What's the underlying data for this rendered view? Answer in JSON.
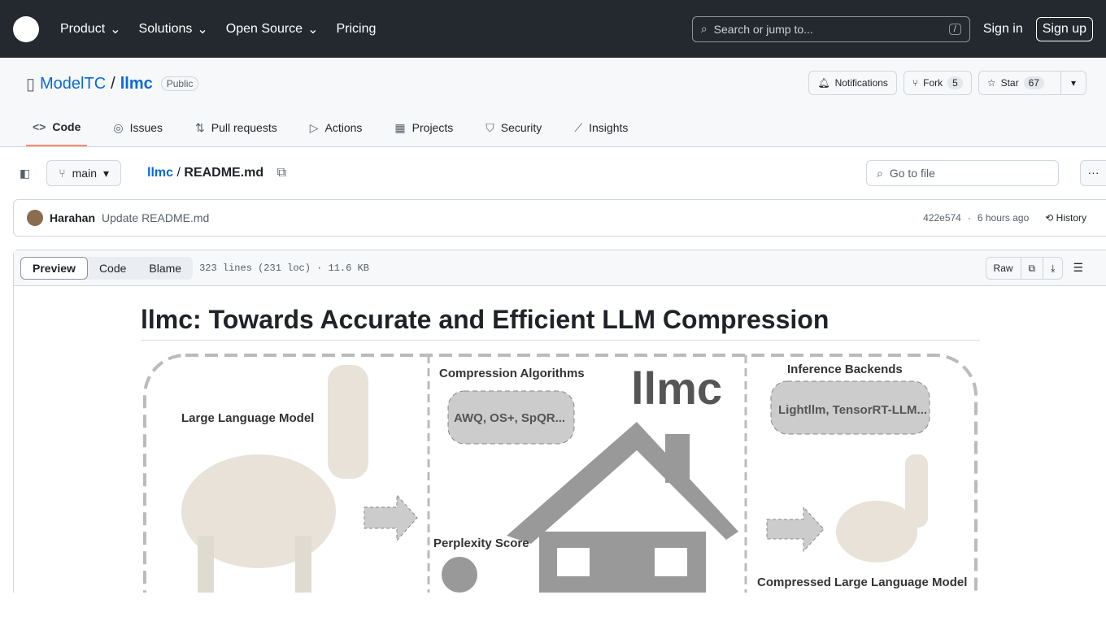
{
  "header": {
    "nav": [
      "Product",
      "Solutions",
      "Open Source",
      "Pricing"
    ],
    "search_placeholder": "Search or jump to...",
    "search_key": "/",
    "sign_in": "Sign in",
    "sign_up": "Sign up"
  },
  "repo": {
    "owner": "ModelTC",
    "name": "llmc",
    "visibility": "Public",
    "notifications": "Notifications",
    "fork": "Fork",
    "fork_count": "5",
    "star": "Star",
    "star_count": "67"
  },
  "tabs": [
    "Code",
    "Issues",
    "Pull requests",
    "Actions",
    "Projects",
    "Security",
    "Insights"
  ],
  "file": {
    "branch": "main",
    "repo": "llmc",
    "path": "README.md",
    "goto": "Go to file"
  },
  "commit": {
    "author": "Harahan",
    "message": "Update README.md",
    "sha": "422e574",
    "time": "6 hours ago",
    "history": "History"
  },
  "viewer": {
    "modes": [
      "Preview",
      "Code",
      "Blame"
    ],
    "info": "323 lines (231 loc) · 11.6 KB",
    "raw": "Raw"
  },
  "readme": {
    "title": "llmc: Towards Accurate and Efficient LLM Compression",
    "figure": {
      "llm": "Large Language Model",
      "algos": "Compression Algorithms",
      "algo_list": "AWQ, OS+, SpQR...",
      "logo": "llmc",
      "backends": "Inference Backends",
      "backend_list": "Lightllm, TensorRT-LLM...",
      "perplexity": "Perplexity Score",
      "compressed": "Compressed Large Language Model"
    }
  }
}
